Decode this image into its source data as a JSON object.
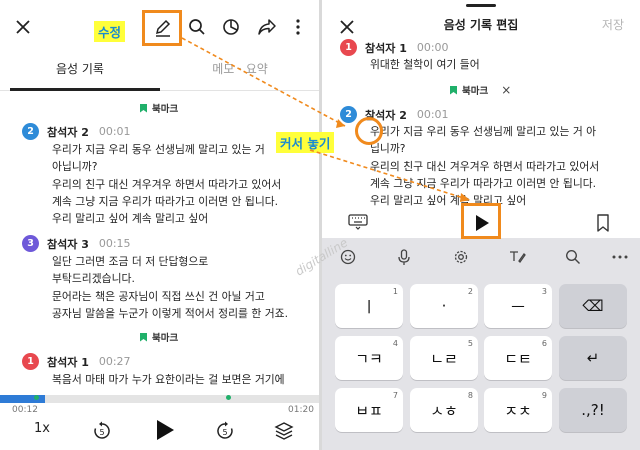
{
  "left": {
    "toolbar": {
      "close_icon": "close-icon",
      "edit_icon": "pencil-icon",
      "search_icon": "search-icon",
      "summary_icon": "pie-chart-icon",
      "share_icon": "share-icon",
      "more_icon": "more-vertical-icon"
    },
    "tabs": [
      {
        "label": "음성 기록",
        "active": true
      },
      {
        "label": "메모 · 요약",
        "active": false
      }
    ],
    "bookmarks": [
      {
        "label": "북마크"
      },
      {
        "label": "북마크"
      }
    ],
    "entries": [
      {
        "num": "2",
        "name": "참석자 2",
        "time": "00:01",
        "color": "#2e8bd8",
        "lines": [
          "우리가 지금 우리 동우 선생님께 말리고 있는 거",
          "아닙니까?",
          "우리의 친구 대신 겨우겨우 하면서 따라가고 있어서",
          "계속 그냥 지금 우리가 따라가고 이러면 안 됩니다.",
          "우리 말리고 싶어 계속 말리고 싶어"
        ]
      },
      {
        "num": "3",
        "name": "참석자 3",
        "time": "00:15",
        "color": "#6e59d9",
        "lines": [
          "일단 그러면 조금 더 저 단답형으로",
          "부탁드리겠습니다.",
          "문어라는 책은 공자님이 직접 쓰신 건 아닐 거고",
          "공자님 말씀을 누군가 이렇게 적어서 정리를 한 거죠."
        ]
      },
      {
        "num": "1",
        "name": "참석자 1",
        "time": "00:27",
        "color": "#e8484f",
        "lines": [
          "복음서 마태 마가 누가 요한이라는 걸 보면은 거기에"
        ]
      }
    ],
    "progress": {
      "elapsed": "00:12",
      "total": "01:20",
      "fraction": 0.14
    },
    "player": {
      "speed": "1x",
      "rewind_label": "5",
      "forward_label": "5",
      "play_icon": "play-icon",
      "layers_icon": "layers-icon"
    },
    "callout_edit": "수정"
  },
  "right": {
    "title": "음성 기록 편집",
    "save_label": "저장",
    "close_icon": "close-icon",
    "prev_entry": {
      "num": "1",
      "name": "참석자 1",
      "time": "00:00",
      "color": "#e8484f",
      "line": "위대한 철학이 여기 들어"
    },
    "bookmark": {
      "label": "북마크",
      "close": "×"
    },
    "entry": {
      "num": "2",
      "name": "참석자 2",
      "time": "00:01",
      "color": "#2e8bd8",
      "lines": [
        "우리가 지금 우리 동우 선생님께 말리고 있는 거 아",
        "닙니까?",
        "우리의 친구 대신 겨우겨우 하면서 따라가고 있어서",
        "계속 그냥 지금 우리가 따라가고 이러면 안 됩니다.",
        "우리 말리고 싶어 계속 말리고 싶어"
      ]
    },
    "callout_cursor": "커서 놓기",
    "kb_tools": [
      "emoji-icon",
      "mic-icon",
      "settings-icon",
      "handwriting-icon",
      "search-icon",
      "more-horizontal-icon"
    ],
    "keys": [
      [
        {
          "label": "ㅣ",
          "num": "1"
        },
        {
          "label": "·",
          "num": "2"
        },
        {
          "label": "ㅡ",
          "num": "3"
        },
        {
          "label": "⌫",
          "num": ""
        }
      ],
      [
        {
          "label": "ㄱㅋ",
          "num": "4"
        },
        {
          "label": "ㄴㄹ",
          "num": "5"
        },
        {
          "label": "ㄷㅌ",
          "num": "6"
        },
        {
          "label": "↵",
          "num": ""
        }
      ],
      [
        {
          "label": "ㅂㅍ",
          "num": "7"
        },
        {
          "label": "ㅅㅎ",
          "num": "8"
        },
        {
          "label": "ㅈㅊ",
          "num": "9"
        },
        {
          "label": ".,?!",
          "num": ""
        }
      ]
    ],
    "watermark": "digitalline"
  }
}
